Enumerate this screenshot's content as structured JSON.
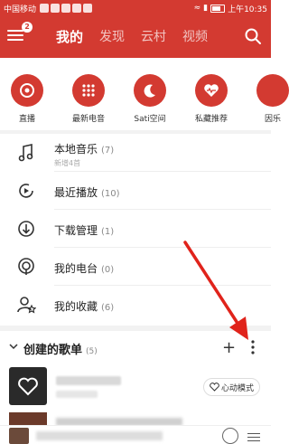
{
  "status_bar": {
    "carrier": "中国移动",
    "time": "上午10:35"
  },
  "header": {
    "menu_badge": "2",
    "tabs": [
      {
        "label": "我的",
        "active": true
      },
      {
        "label": "发现",
        "active": false
      },
      {
        "label": "云村",
        "active": false
      },
      {
        "label": "视频",
        "active": false
      }
    ]
  },
  "quick_actions": [
    {
      "label": "直播",
      "icon": "radio-icon"
    },
    {
      "label": "最新电音",
      "icon": "equalizer-grid-icon"
    },
    {
      "label": "Sati空间",
      "icon": "moon-icon"
    },
    {
      "label": "私藏推荐",
      "icon": "heart-wave-icon"
    },
    {
      "label": "因乐",
      "icon": "partial-icon"
    }
  ],
  "library": [
    {
      "title": "本地音乐",
      "count": "(7)",
      "subtitle": "新增4首",
      "icon": "music-note-icon"
    },
    {
      "title": "最近播放",
      "count": "(10)",
      "subtitle": "",
      "icon": "recent-play-icon"
    },
    {
      "title": "下载管理",
      "count": "(1)",
      "subtitle": "",
      "icon": "download-icon"
    },
    {
      "title": "我的电台",
      "count": "(0)",
      "subtitle": "",
      "icon": "podcast-icon"
    },
    {
      "title": "我的收藏",
      "count": "(6)",
      "subtitle": "",
      "icon": "favorite-user-icon"
    }
  ],
  "created_playlists": {
    "title": "创建的歌单",
    "count": "(5)",
    "add_label": "+",
    "heart_mode_label": "心动模式"
  },
  "colors": {
    "brand": "#d33a31"
  }
}
